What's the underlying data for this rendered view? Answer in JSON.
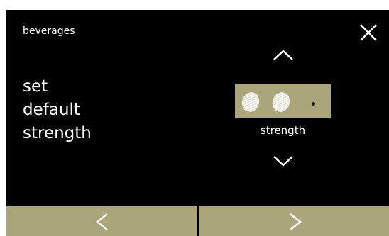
{
  "header": {
    "title": "beverages",
    "close_icon": "close-icon"
  },
  "setting": {
    "title_lines": [
      "set",
      "default",
      "strength"
    ]
  },
  "strength": {
    "label": "strength",
    "level": 2,
    "max_level": 3,
    "up_icon": "chevron-up-icon",
    "down_icon": "chevron-down-icon"
  },
  "footer": {
    "prev_icon": "chevron-left-icon",
    "next_icon": "chevron-right-icon"
  },
  "colors": {
    "background": "#000000",
    "accent": "#aba57a",
    "text": "#ffffff"
  }
}
